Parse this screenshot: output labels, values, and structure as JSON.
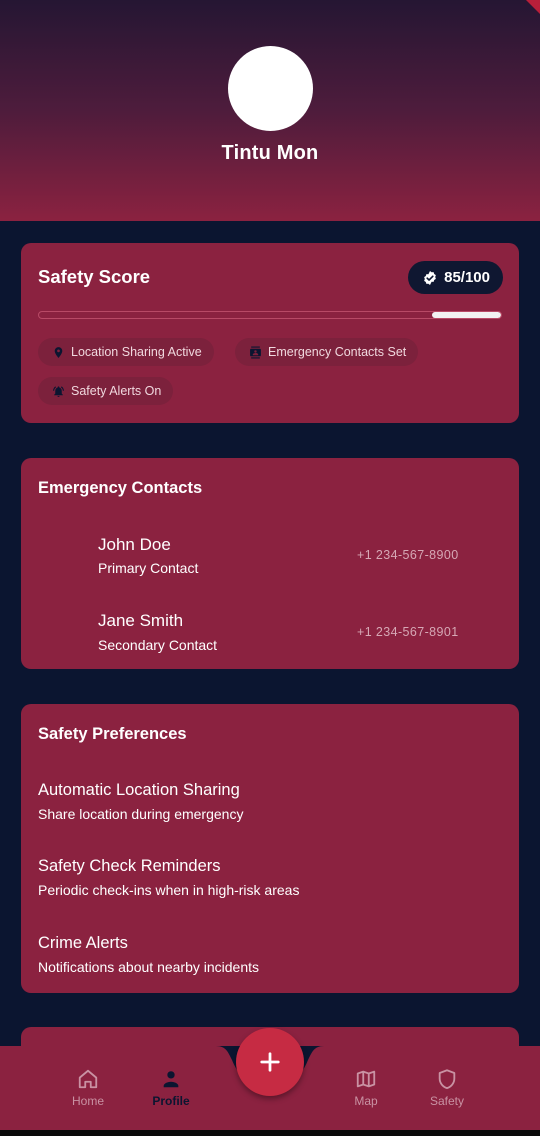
{
  "profile": {
    "name": "Tintu Mon"
  },
  "safety_score": {
    "title": "Safety Score",
    "score_text": "85/100",
    "progress_fraction": 0.85,
    "chips": [
      {
        "label": "Location Sharing Active",
        "icon": "location-pin-icon"
      },
      {
        "label": "Emergency Contacts Set",
        "icon": "contacts-icon"
      },
      {
        "label": "Safety Alerts On",
        "icon": "bell-alert-icon"
      }
    ]
  },
  "emergency_contacts": {
    "title": "Emergency Contacts",
    "contacts": [
      {
        "name": "John Doe",
        "role": "Primary Contact",
        "phone": "+1 234-567-8900"
      },
      {
        "name": "Jane Smith",
        "role": "Secondary Contact",
        "phone": "+1 234-567-8901"
      }
    ]
  },
  "safety_preferences": {
    "title": "Safety Preferences",
    "items": [
      {
        "title": "Automatic Location Sharing",
        "subtitle": "Share location during emergency"
      },
      {
        "title": "Safety Check Reminders",
        "subtitle": "Periodic check-ins when in high-risk areas"
      },
      {
        "title": "Crime Alerts",
        "subtitle": "Notifications about nearby incidents"
      }
    ]
  },
  "bottom_nav": {
    "items": [
      {
        "label": "Home",
        "icon": "home-icon",
        "active": false
      },
      {
        "label": "Profile",
        "icon": "person-icon",
        "active": true
      },
      {
        "label": "Map",
        "icon": "map-icon",
        "active": false
      },
      {
        "label": "Safety",
        "icon": "shield-icon",
        "active": false
      }
    ],
    "fab_icon": "plus-icon"
  },
  "colors": {
    "background": "#0b1530",
    "card": "#8b2240",
    "accent": "#c62b43",
    "badge": "#0f1731"
  }
}
